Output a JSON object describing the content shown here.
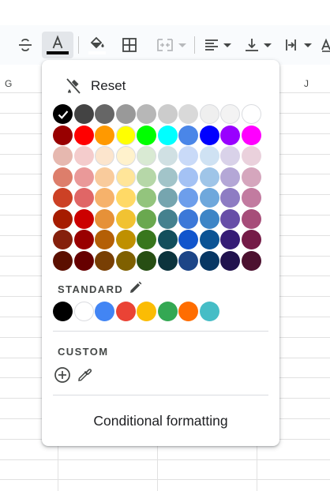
{
  "grid": {
    "columns": [
      "G",
      "J"
    ]
  },
  "toolbar": {
    "items": [
      {
        "name": "strikethrough-icon"
      },
      {
        "name": "text-color-icon",
        "active": true,
        "underline_color": "#000000"
      },
      {
        "name": "fill-color-icon"
      },
      {
        "name": "borders-icon"
      },
      {
        "name": "merge-cells-icon",
        "disabled": true
      },
      {
        "name": "horizontal-align-icon"
      },
      {
        "name": "vertical-align-icon"
      },
      {
        "name": "text-wrapping-icon"
      },
      {
        "name": "text-rotation-icon"
      }
    ]
  },
  "popup": {
    "reset_label": "Reset",
    "selected_color": "#000000",
    "palette": [
      [
        "#000000",
        "#434343",
        "#666666",
        "#999999",
        "#b7b7b7",
        "#cccccc",
        "#d9d9d9",
        "#efefef",
        "#f3f3f3",
        "#ffffff"
      ],
      [
        "#980000",
        "#ff0000",
        "#ff9900",
        "#ffff00",
        "#00ff00",
        "#00ffff",
        "#4a86e8",
        "#0000ff",
        "#9900ff",
        "#ff00ff"
      ],
      [
        "#e6b8af",
        "#f4cccc",
        "#fce5cd",
        "#fff2cc",
        "#d9ead3",
        "#d0e0e3",
        "#c9daf8",
        "#cfe2f3",
        "#d9d2e9",
        "#ead1dc"
      ],
      [
        "#dd7e6b",
        "#ea9999",
        "#f9cb9c",
        "#ffe599",
        "#b6d7a8",
        "#a2c4c9",
        "#a4c2f4",
        "#9fc5e8",
        "#b4a7d6",
        "#d5a6bd"
      ],
      [
        "#cc4125",
        "#e06666",
        "#f6b26b",
        "#ffd966",
        "#93c47d",
        "#76a5af",
        "#6d9eeb",
        "#6fa8dc",
        "#8e7cc3",
        "#c27ba0"
      ],
      [
        "#a61c00",
        "#cc0000",
        "#e69138",
        "#f1c232",
        "#6aa84f",
        "#45818e",
        "#3c78d8",
        "#3d85c6",
        "#674ea7",
        "#a64d79"
      ],
      [
        "#85200c",
        "#990000",
        "#b45f06",
        "#bf9000",
        "#38761d",
        "#134f5c",
        "#1155cc",
        "#0b5394",
        "#351c75",
        "#741b47"
      ],
      [
        "#5b0f00",
        "#660000",
        "#783f04",
        "#7f6000",
        "#274e13",
        "#0c343d",
        "#1c4587",
        "#073763",
        "#20124d",
        "#4c1130"
      ]
    ],
    "standard_label": "STANDARD",
    "standard_colors": [
      "#000000",
      "#ffffff",
      "#4285f4",
      "#ea4335",
      "#fbbc04",
      "#34a853",
      "#ff6d01",
      "#46bdc6"
    ],
    "custom_label": "CUSTOM",
    "conditional_formatting_label": "Conditional formatting"
  }
}
